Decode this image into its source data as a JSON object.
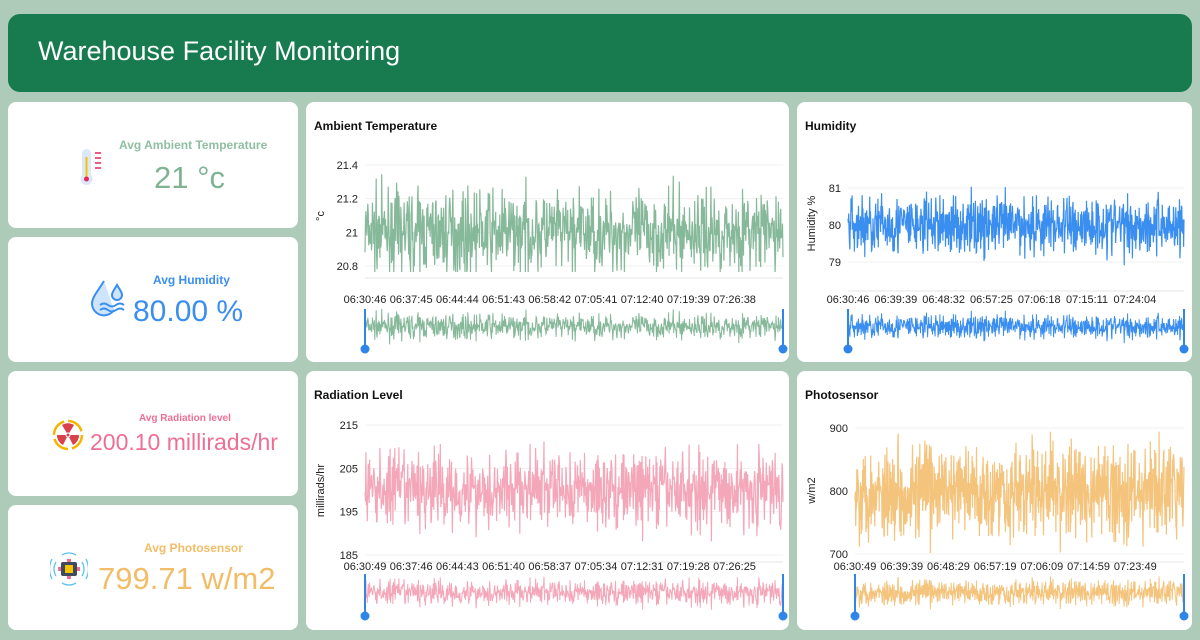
{
  "header": {
    "title": "Warehouse Facility Monitoring"
  },
  "kpis": [
    {
      "label": "Avg Ambient Temperature",
      "value": "21 °c",
      "color": "#7fb394",
      "icon": "thermometer-icon"
    },
    {
      "label": "Avg Humidity",
      "value": "80.00 %",
      "color": "#3a8ef0",
      "icon": "water-drop-icon"
    },
    {
      "label": "Avg Radiation level",
      "value": "200.10 millirads/hr",
      "color": "#ef6f94",
      "icon": "radiation-icon"
    },
    {
      "label": "Avg Photosensor",
      "value": "799.71 w/m2",
      "color": "#f2bd68",
      "icon": "photosensor-chip-icon"
    }
  ],
  "chart_data": [
    {
      "type": "line",
      "title": "Ambient Temperature",
      "ylabel": "°c",
      "color": "#86b89a",
      "yticks": [
        "21.4",
        "21.2",
        "21",
        "20.8"
      ],
      "ylim": [
        20.65,
        21.45
      ],
      "mean": 21.0,
      "spread": 0.12,
      "xticks": [
        "06:30:46",
        "06:37:45",
        "06:44:44",
        "06:51:43",
        "06:58:42",
        "07:05:41",
        "07:12:40",
        "07:19:39",
        "07:26:38"
      ],
      "navigator": true
    },
    {
      "type": "line",
      "title": "Humidity",
      "ylabel": "Humidity %",
      "color": "#3a8ef0",
      "yticks": [
        "81",
        "80",
        "79"
      ],
      "ylim": [
        78.6,
        81.5
      ],
      "mean": 80.0,
      "spread": 0.4,
      "xticks": [
        "06:30:46",
        "06:39:39",
        "06:48:32",
        "06:57:25",
        "07:06:18",
        "07:15:11",
        "07:24:04"
      ],
      "navigator": true
    },
    {
      "type": "line",
      "title": "Radiation Level",
      "ylabel": "millirads/hr",
      "color": "#f4a7b9",
      "yticks": [
        "215",
        "205",
        "195",
        "185"
      ],
      "ylim": [
        185,
        215
      ],
      "mean": 200.1,
      "spread": 4.5,
      "xticks": [
        "06:30:49",
        "06:37:46",
        "06:44:43",
        "06:51:40",
        "06:58:37",
        "07:05:34",
        "07:12:31",
        "07:19:28",
        "07:26:25"
      ],
      "navigator": true
    },
    {
      "type": "line",
      "title": "Photosensor",
      "ylabel": "w/m2",
      "color": "#f4c37c",
      "yticks": [
        "900",
        "800",
        "700"
      ],
      "ylim": [
        700,
        900
      ],
      "mean": 799.7,
      "spread": 38,
      "xticks": [
        "06:30:49",
        "06:39:39",
        "06:48:29",
        "06:57:19",
        "07:06:09",
        "07:14:59",
        "07:23:49"
      ],
      "navigator": true
    }
  ]
}
